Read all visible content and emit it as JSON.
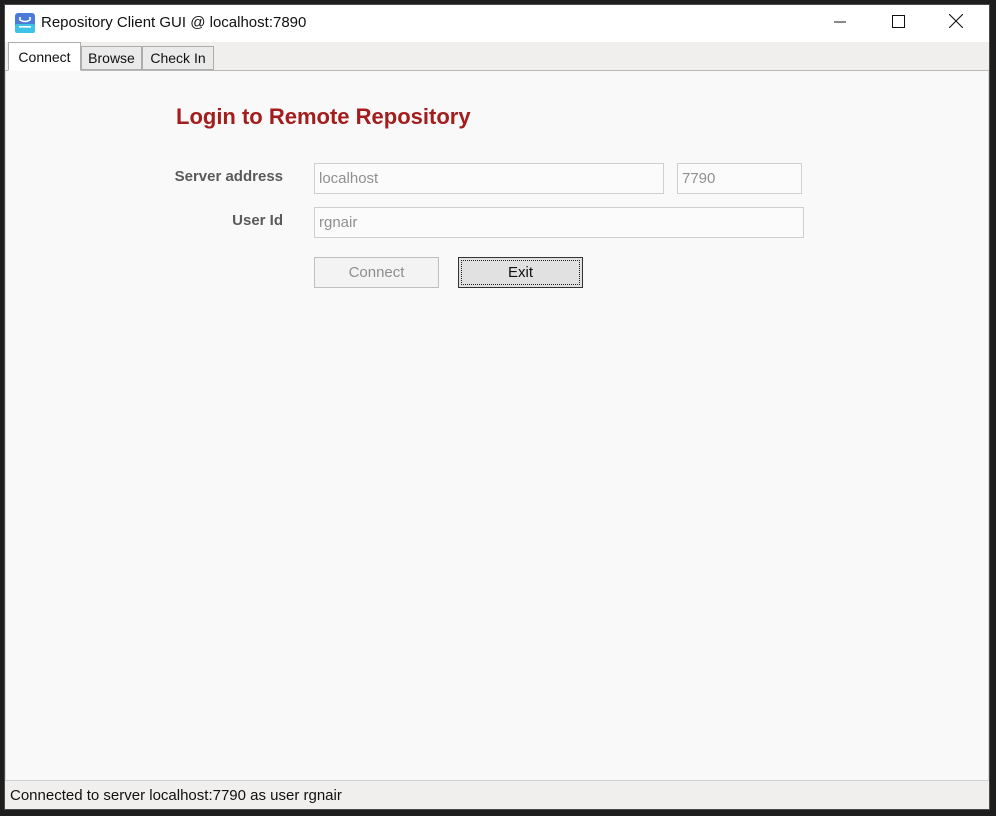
{
  "window": {
    "title": "Repository Client GUI @ localhost:7890",
    "app_icon": "repository-app-icon",
    "controls": {
      "minimize_icon": "minimize-icon",
      "maximize_icon": "maximize-icon",
      "close_icon": "close-icon"
    }
  },
  "tabs": [
    {
      "label": "Connect",
      "active": true
    },
    {
      "label": "Browse",
      "active": false
    },
    {
      "label": "Check In",
      "active": false
    }
  ],
  "connect_page": {
    "heading": "Login to Remote Repository",
    "server_address_label": "Server address",
    "server_address_value": "localhost",
    "port_value": "7790",
    "user_id_label": "User Id",
    "user_id_value": "rgnair",
    "connect_button": "Connect",
    "exit_button": "Exit"
  },
  "status": {
    "text": "Connected to server localhost:7790 as user rgnair"
  },
  "colors": {
    "heading": "#a31d1d",
    "label": "#5a5a5a",
    "disabled_text": "#909090",
    "content_bg": "#f9f9f9",
    "chrome_bg": "#f0efee"
  }
}
